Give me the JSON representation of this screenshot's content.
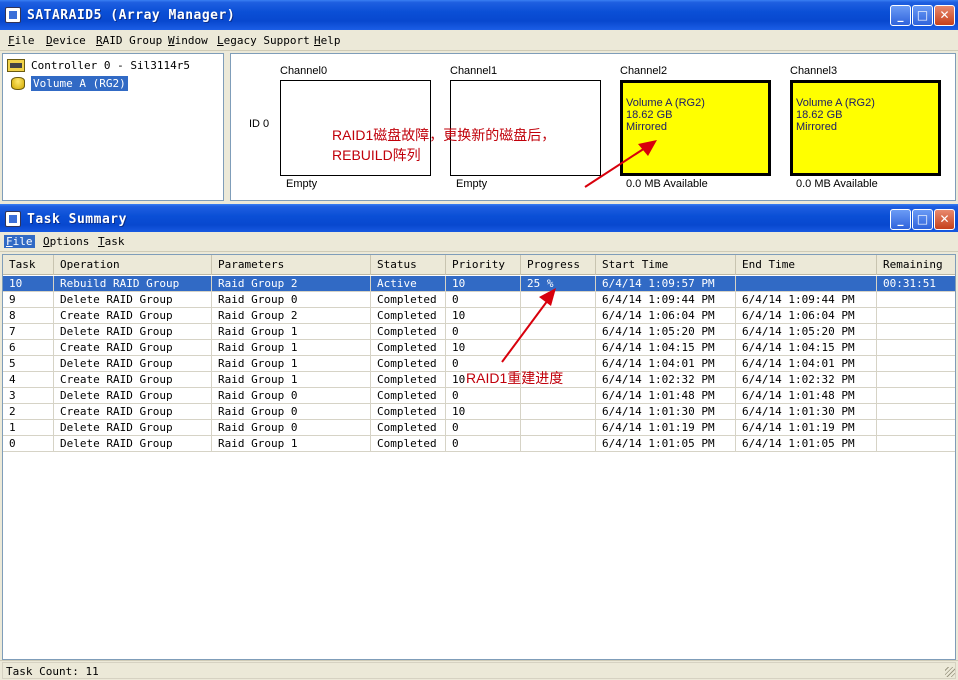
{
  "main_window": {
    "title": "SATARAID5 (Array Manager)",
    "menu": [
      "File",
      "Device",
      "RAID Group",
      "Window",
      "Legacy Support",
      "Help"
    ]
  },
  "tree": {
    "controller": "Controller 0 - Sil3114r5",
    "volume": "Volume A (RG2)"
  },
  "channels": {
    "id_label": "ID 0",
    "items": [
      {
        "label": "Channel0",
        "footer": "Empty",
        "volume": null
      },
      {
        "label": "Channel1",
        "footer": "Empty",
        "volume": null
      },
      {
        "label": "Channel2",
        "footer": "0.0 MB Available",
        "volume": {
          "name": "Volume A (RG2)",
          "size": "18.62 GB",
          "type": "Mirrored"
        }
      },
      {
        "label": "Channel3",
        "footer": "0.0 MB Available",
        "volume": {
          "name": "Volume A (RG2)",
          "size": "18.62 GB",
          "type": "Mirrored"
        }
      }
    ]
  },
  "annotations": {
    "disk_fault_line1": "RAID1磁盘故障，更换新的磁盘后，",
    "disk_fault_line2": "REBUILD阵列",
    "rebuild_progress": "RAID1重建进度",
    "color": "#c0000a"
  },
  "task_window": {
    "title": "Task Summary",
    "menu": [
      "File",
      "Options",
      "Task"
    ],
    "columns": [
      "Task",
      "Operation",
      "Parameters",
      "Status",
      "Priority",
      "Progress",
      "Start Time",
      "End Time",
      "Remaining"
    ],
    "rows": [
      [
        "10",
        "Rebuild RAID Group",
        "Raid Group 2",
        "Active",
        "10",
        "25 %",
        "6/4/14 1:09:57 PM",
        "",
        "00:31:51"
      ],
      [
        "9",
        "Delete RAID Group",
        "Raid Group 0",
        "Completed",
        "0",
        "",
        "6/4/14 1:09:44 PM",
        "6/4/14 1:09:44 PM",
        ""
      ],
      [
        "8",
        "Create RAID Group",
        "Raid Group 2",
        "Completed",
        "10",
        "",
        "6/4/14 1:06:04 PM",
        "6/4/14 1:06:04 PM",
        ""
      ],
      [
        "7",
        "Delete RAID Group",
        "Raid Group 1",
        "Completed",
        "0",
        "",
        "6/4/14 1:05:20 PM",
        "6/4/14 1:05:20 PM",
        ""
      ],
      [
        "6",
        "Create RAID Group",
        "Raid Group 1",
        "Completed",
        "10",
        "",
        "6/4/14 1:04:15 PM",
        "6/4/14 1:04:15 PM",
        ""
      ],
      [
        "5",
        "Delete RAID Group",
        "Raid Group 1",
        "Completed",
        "0",
        "",
        "6/4/14 1:04:01 PM",
        "6/4/14 1:04:01 PM",
        ""
      ],
      [
        "4",
        "Create RAID Group",
        "Raid Group 1",
        "Completed",
        "10",
        "",
        "6/4/14 1:02:32 PM",
        "6/4/14 1:02:32 PM",
        ""
      ],
      [
        "3",
        "Delete RAID Group",
        "Raid Group 0",
        "Completed",
        "0",
        "",
        "6/4/14 1:01:48 PM",
        "6/4/14 1:01:48 PM",
        ""
      ],
      [
        "2",
        "Create RAID Group",
        "Raid Group 0",
        "Completed",
        "10",
        "",
        "6/4/14 1:01:30 PM",
        "6/4/14 1:01:30 PM",
        ""
      ],
      [
        "1",
        "Delete RAID Group",
        "Raid Group 0",
        "Completed",
        "0",
        "",
        "6/4/14 1:01:19 PM",
        "6/4/14 1:01:19 PM",
        ""
      ],
      [
        "0",
        "Delete RAID Group",
        "Raid Group 1",
        "Completed",
        "0",
        "",
        "6/4/14 1:01:05 PM",
        "6/4/14 1:01:05 PM",
        ""
      ]
    ],
    "status_text": "Task Count: 11"
  },
  "colors": {
    "volume_fill": "#ffff00",
    "selection": "#316ac5"
  },
  "icons": [
    "app-icon",
    "controller-icon",
    "volume-icon",
    "minimize-icon",
    "maximize-icon",
    "close-icon"
  ]
}
